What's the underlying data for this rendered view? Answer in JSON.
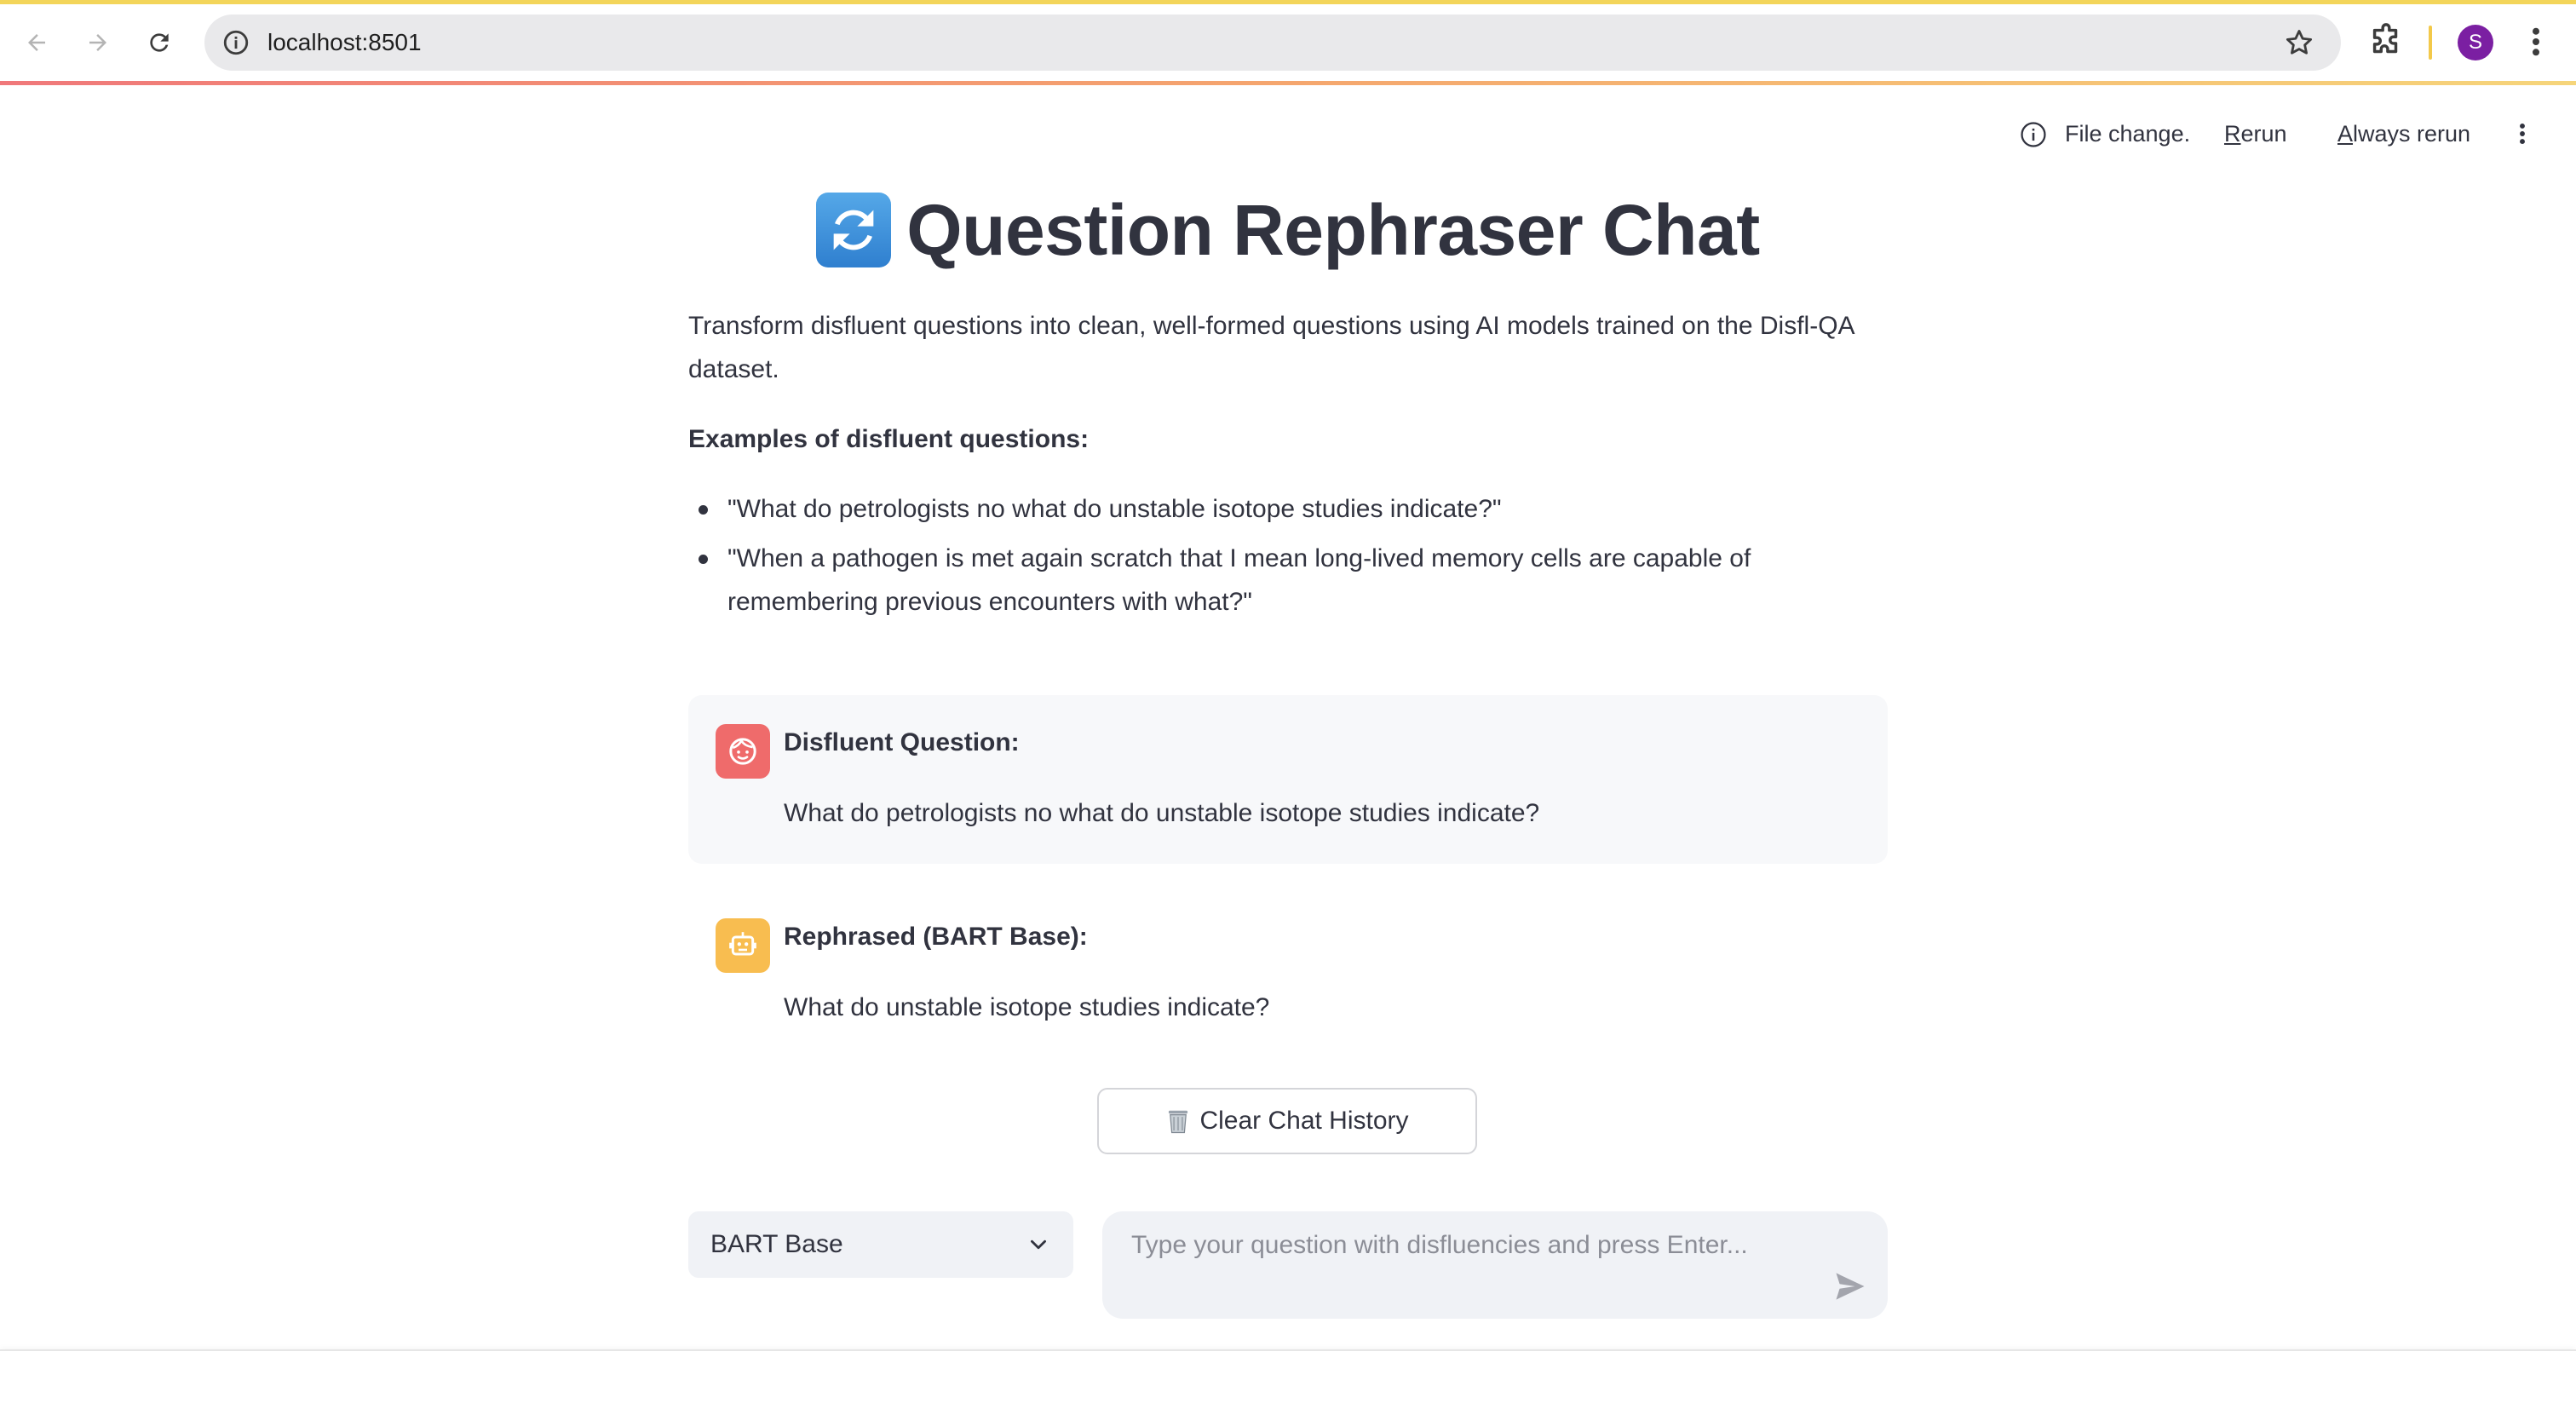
{
  "browser": {
    "url": "localhost:8501",
    "profile_initial": "S",
    "accent_color": "#f3d55a"
  },
  "toolbar": {
    "status_text": "File change.",
    "rerun_label_first": "R",
    "rerun_label_rest": "erun",
    "always_rerun_label_first": "A",
    "always_rerun_label_rest": "lways rerun"
  },
  "app": {
    "title": "Question Rephraser Chat",
    "title_icon": "arrows-clockwise-icon",
    "description": "Transform disfluent questions into clean, well-formed questions using AI models trained on the Disfl-QA dataset.",
    "examples_label": "Examples of disfluent questions:",
    "examples": [
      "\"What do petrologists no what do unstable isotope studies indicate?\"",
      "\"When a pathogen is met again scratch that I mean long-lived memory cells are capable of remembering previous encounters with what?\""
    ]
  },
  "chat": {
    "messages": [
      {
        "role": "user",
        "avatar_color": "#ef6b6b",
        "heading": "Disfluent Question:",
        "text": "What do petrologists no what do unstable isotope studies indicate?"
      },
      {
        "role": "assistant",
        "avatar_color": "#f8bd50",
        "heading": "Rephrased (BART Base):",
        "text": "What do unstable isotope studies indicate?"
      }
    ],
    "clear_button": "Clear Chat History",
    "clear_icon": "wastebasket-icon"
  },
  "controls": {
    "model_select_value": "BART Base",
    "input_placeholder": "Type your question with disfluencies and press Enter..."
  }
}
